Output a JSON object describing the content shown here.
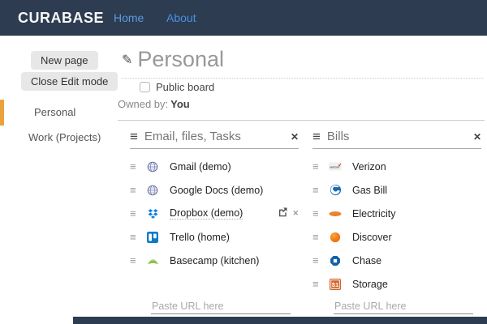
{
  "header": {
    "brand": "CURABASE",
    "nav": [
      {
        "label": "Home"
      },
      {
        "label": "About"
      }
    ]
  },
  "sidebar": {
    "buttons": [
      {
        "label": "New page"
      },
      {
        "label": "Close Edit mode"
      }
    ],
    "items": [
      {
        "label": "Personal",
        "active": true
      },
      {
        "label": "Work (Projects)",
        "active": false
      }
    ]
  },
  "board": {
    "title": "Personal",
    "public_label": "Public board",
    "public_checked": false,
    "owned_by_label": "Owned by:",
    "owner": "You"
  },
  "columns": [
    {
      "title": "Email, files, Tasks",
      "close_icon": "✕",
      "paste_placeholder": "Paste URL here",
      "items": [
        {
          "label": "Gmail (demo)",
          "icon": "globe-icon",
          "editing": false
        },
        {
          "label": "Google Docs (demo)",
          "icon": "globe-icon",
          "editing": false
        },
        {
          "label": "Dropbox (demo)",
          "icon": "dropbox-icon",
          "editing": true
        },
        {
          "label": "Trello (home)",
          "icon": "trello-icon",
          "editing": false
        },
        {
          "label": "Basecamp (kitchen)",
          "icon": "basecamp-icon",
          "editing": false
        }
      ]
    },
    {
      "title": "Bills",
      "close_icon": "✕",
      "paste_placeholder": "Paste URL here",
      "items": [
        {
          "label": "Verizon",
          "icon": "verizon-icon",
          "editing": false
        },
        {
          "label": "Gas Bill",
          "icon": "gas-icon",
          "editing": false
        },
        {
          "label": "Electricity",
          "icon": "electricity-icon",
          "editing": false
        },
        {
          "label": "Discover",
          "icon": "discover-icon",
          "editing": false
        },
        {
          "label": "Chase",
          "icon": "chase-icon",
          "editing": false
        },
        {
          "label": "Storage",
          "icon": "storage-icon",
          "editing": false
        }
      ]
    }
  ],
  "glyphs": {
    "pencil": "✎",
    "handle": "≡",
    "close": "✕",
    "remove": "✕"
  },
  "colors": {
    "header_bg": "#2d3c50",
    "nav_link": "#4a90e2",
    "accent_orange": "#eaa23c",
    "title_gray": "#98989a",
    "dropbox_blue": "#0d82e8",
    "trello_blue": "#0a7cc4",
    "basecamp_green": "#8cc04a",
    "chase_blue": "#1260a8",
    "discover_orange": "#f5821f",
    "storage_orange": "#d2622a",
    "gas_blue": "#1a6ab0",
    "electricity_orange": "#e8872e"
  }
}
